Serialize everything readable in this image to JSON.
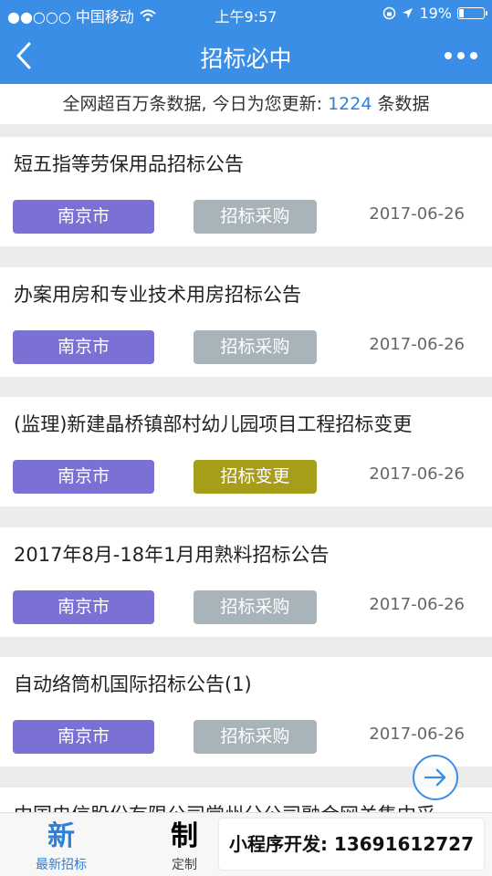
{
  "status": {
    "carrier": "●●○○○ 中国移动",
    "time": "上午9:57",
    "battery": "19%",
    "battery_level": 0.19
  },
  "nav": {
    "title": "招标必中"
  },
  "info": {
    "prefix": "全网超百万条数据, 今日为您更新: ",
    "count": "1224",
    "suffix": " 条数据"
  },
  "items": [
    {
      "title": "短五指等劳保用品招标公告",
      "city": "南京市",
      "type": "招标采购",
      "date": "2017-06-26"
    },
    {
      "title": "办案用房和专业技术用房招标公告",
      "city": "南京市",
      "type": "招标采购",
      "date": "2017-06-26"
    },
    {
      "title": "(监理)新建晶桥镇部村幼儿园项目工程招标变更",
      "city": "南京市",
      "type": "招标变更",
      "date": "2017-06-26"
    },
    {
      "title": "2017年8月-18年1月用熟料招标公告",
      "city": "南京市",
      "type": "招标采购",
      "date": "2017-06-26"
    },
    {
      "title": "自动络筒机国际招标公告(1)",
      "city": "南京市",
      "type": "招标采购",
      "date": "2017-06-26"
    }
  ],
  "partial_item": {
    "title": "中国电信股份有限公司常州分公司融合网关集中采"
  },
  "tabs": [
    {
      "glyph": "新",
      "label": "最新招标"
    },
    {
      "glyph": "制",
      "label": "定制"
    }
  ],
  "watermark": "小程序开发: 13691612727",
  "colors": {
    "primary": "#3b8ee6",
    "city_tag": "#7b70d4",
    "type_tag": "#a9b4ba",
    "change_tag": "#a69e1b"
  }
}
